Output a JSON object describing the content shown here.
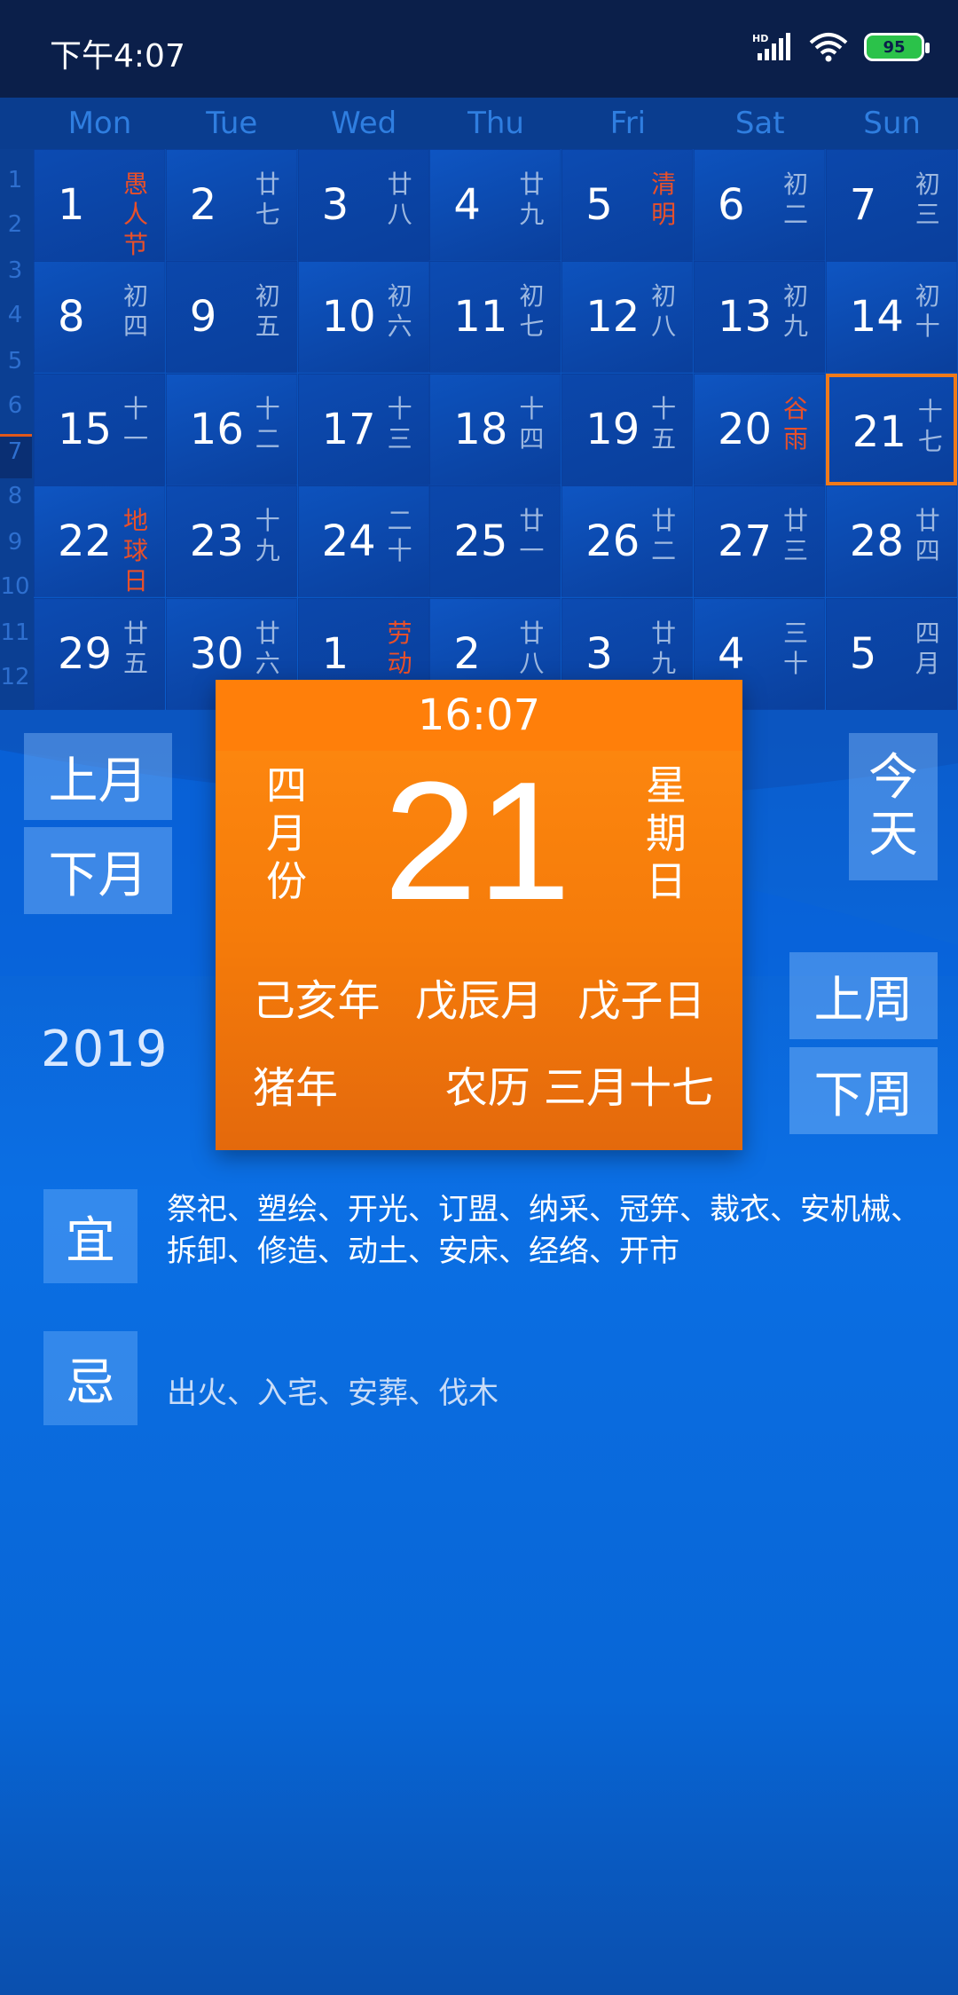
{
  "status_bar": {
    "time": "下午4:07",
    "battery": "95"
  },
  "weekdays": [
    "Mon",
    "Tue",
    "Wed",
    "Thu",
    "Fri",
    "Sat",
    "Sun"
  ],
  "week_numbers": [
    "1",
    "2",
    "3",
    "4",
    "5",
    "6",
    "7",
    "8",
    "9",
    "10",
    "11",
    "12"
  ],
  "calendar": {
    "rows": [
      [
        {
          "day": "1",
          "lunar": "愚人节",
          "red": true
        },
        {
          "day": "2",
          "lunar": "廿七"
        },
        {
          "day": "3",
          "lunar": "廿八"
        },
        {
          "day": "4",
          "lunar": "廿九"
        },
        {
          "day": "5",
          "lunar": "清明",
          "red": true
        },
        {
          "day": "6",
          "lunar": "初二"
        },
        {
          "day": "7",
          "lunar": "初三"
        }
      ],
      [
        {
          "day": "8",
          "lunar": "初四"
        },
        {
          "day": "9",
          "lunar": "初五"
        },
        {
          "day": "10",
          "lunar": "初六"
        },
        {
          "day": "11",
          "lunar": "初七"
        },
        {
          "day": "12",
          "lunar": "初八"
        },
        {
          "day": "13",
          "lunar": "初九"
        },
        {
          "day": "14",
          "lunar": "初十"
        }
      ],
      [
        {
          "day": "15",
          "lunar": "十一"
        },
        {
          "day": "16",
          "lunar": "十二"
        },
        {
          "day": "17",
          "lunar": "十三"
        },
        {
          "day": "18",
          "lunar": "十四"
        },
        {
          "day": "19",
          "lunar": "十五"
        },
        {
          "day": "20",
          "lunar": "谷雨",
          "red": true
        },
        {
          "day": "21",
          "lunar": "十七",
          "today": true
        }
      ],
      [
        {
          "day": "22",
          "lunar": "地球日",
          "red": true
        },
        {
          "day": "23",
          "lunar": "十九"
        },
        {
          "day": "24",
          "lunar": "二十"
        },
        {
          "day": "25",
          "lunar": "廿一"
        },
        {
          "day": "26",
          "lunar": "廿二"
        },
        {
          "day": "27",
          "lunar": "廿三"
        },
        {
          "day": "28",
          "lunar": "廿四"
        }
      ],
      [
        {
          "day": "29",
          "lunar": "廿五"
        },
        {
          "day": "30",
          "lunar": "廿六"
        },
        {
          "day": "1",
          "lunar": "劳动节",
          "red": true
        },
        {
          "day": "2",
          "lunar": "廿八"
        },
        {
          "day": "3",
          "lunar": "廿九"
        },
        {
          "day": "4",
          "lunar": "三十"
        },
        {
          "day": "5",
          "lunar": "四月"
        }
      ]
    ]
  },
  "nav": {
    "prev_month": "上月",
    "next_month": "下月",
    "today": "今天",
    "prev_week": "上周",
    "next_week": "下周"
  },
  "year": "2019",
  "popup": {
    "time": "16:07",
    "month": "四月份",
    "day": "21",
    "weekday": "星期日",
    "year_gz": "己亥年",
    "month_gz": "戊辰月",
    "day_gz": "戊子日",
    "zodiac": "猪年",
    "lunar_date": "农历 三月十七"
  },
  "yi": {
    "label": "宜",
    "text": "祭祀、塑绘、开光、订盟、纳采、冠笄、裁衣、安机械、拆卸、修造、动土、安床、经络、开市"
  },
  "ji": {
    "label": "忌",
    "text": "出火、入宅、安葬、伐木"
  },
  "colors": {
    "accent": "#f07a1a",
    "holiday": "#e8502a",
    "status_bg": "#0b1f4a"
  }
}
